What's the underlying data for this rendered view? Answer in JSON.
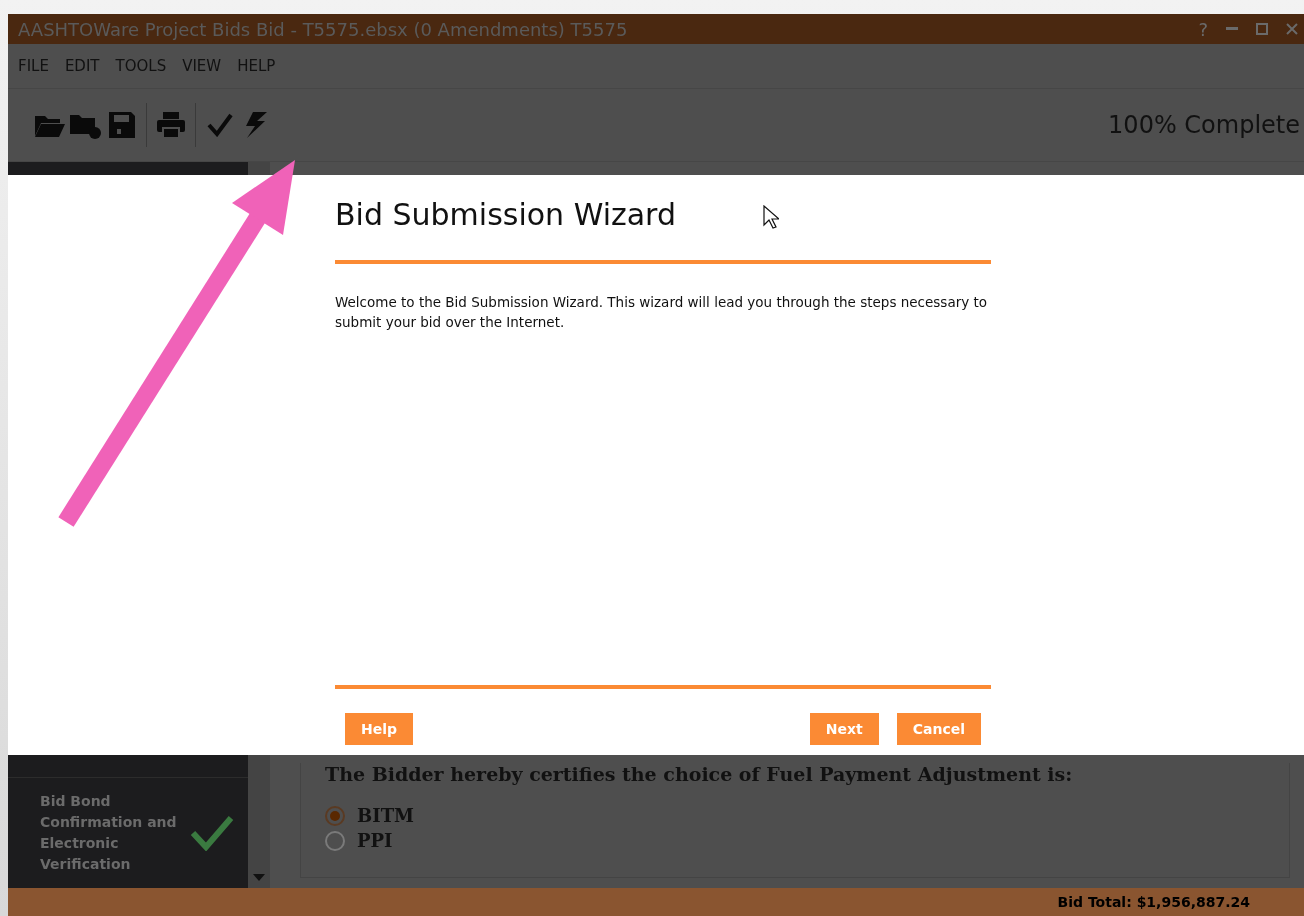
{
  "window": {
    "title": "AASHTOWare Project Bids Bid - T5575.ebsx (0 Amendments) T5575",
    "help_glyph": "?"
  },
  "menu": [
    "FILE",
    "EDIT",
    "TOOLS",
    "VIEW",
    "HELP"
  ],
  "toolbar": {
    "progress": "100% Complete"
  },
  "sidebar": {
    "items": [
      {
        "label": "Bid Bond Confirmation and Electronic Verification",
        "complete": true
      }
    ]
  },
  "content": {
    "question": "The Bidder hereby certifies the choice of Fuel Payment Adjustment is:",
    "options": [
      {
        "label": "BITM",
        "selected": true
      },
      {
        "label": "PPI",
        "selected": false
      }
    ]
  },
  "dialog": {
    "title": "Bid Submission Wizard",
    "message": "Welcome to the Bid Submission Wizard. This wizard will lead you through the steps necessary to submit your bid over the Internet.",
    "buttons": [
      {
        "label": "Help",
        "kind": "left"
      },
      {
        "label": "Next",
        "kind": "right"
      },
      {
        "label": "Cancel",
        "kind": "right"
      }
    ]
  },
  "status_bar": {
    "bid_total": "Bid Total: $1,956,887.24"
  }
}
